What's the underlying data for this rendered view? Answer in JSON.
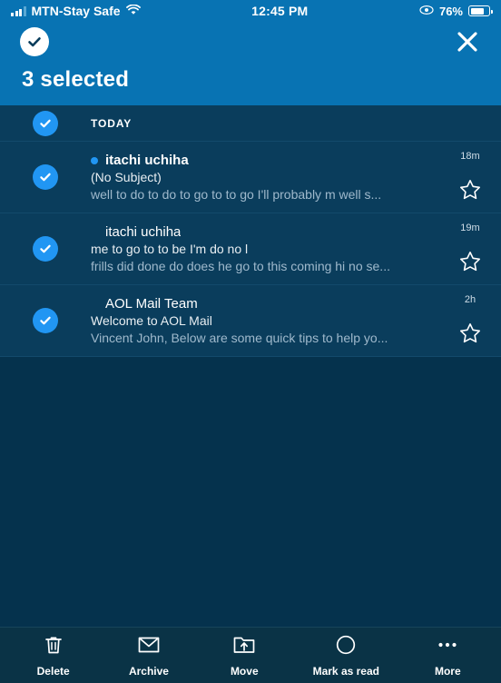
{
  "status_bar": {
    "carrier": "MTN-Stay Safe",
    "time": "12:45 PM",
    "battery_percent": "76%",
    "signal_icon": "signal-bars-icon",
    "wifi_icon": "wifi-icon",
    "eye_icon": "eye-icon",
    "battery_icon": "battery-icon"
  },
  "header": {
    "select_all_icon": "check-circle-icon",
    "close_icon": "close-icon",
    "title": "3 selected",
    "accent_color": "#0873b3"
  },
  "list": {
    "section_label": "TODAY",
    "section_checkbox_icon": "checkbox-checked-icon",
    "row_bg_color": "#0a3d5c",
    "checkbox_color": "#2196f3",
    "emails": [
      {
        "sender": "itachi uchiha",
        "subject": "(No Subject)",
        "preview": "well to do to do to go to to go I'll probably m well s...",
        "time": "18m",
        "unread": true,
        "selected": true,
        "star_icon": "star-outline-icon",
        "unread_dot_icon": "unread-dot-icon"
      },
      {
        "sender": "itachi uchiha",
        "subject": "me to go to to be I'm do no l",
        "preview": "frills did done do does he go to this coming hi no se...",
        "time": "19m",
        "unread": false,
        "selected": true,
        "star_icon": "star-outline-icon",
        "unread_dot_icon": "unread-dot-icon"
      },
      {
        "sender": "AOL Mail Team",
        "subject": "Welcome to AOL Mail",
        "preview": "Vincent John, Below are some quick tips to help yo...",
        "time": "2h",
        "unread": false,
        "selected": true,
        "star_icon": "star-outline-icon",
        "unread_dot_icon": "unread-dot-icon"
      }
    ]
  },
  "toolbar": {
    "background_color": "#0a3346",
    "items": [
      {
        "label": "Delete",
        "icon": "trash-icon"
      },
      {
        "label": "Archive",
        "icon": "archive-icon"
      },
      {
        "label": "Move",
        "icon": "move-folder-icon"
      },
      {
        "label": "Mark as read",
        "icon": "circle-icon"
      },
      {
        "label": "More",
        "icon": "ellipsis-icon"
      }
    ]
  }
}
